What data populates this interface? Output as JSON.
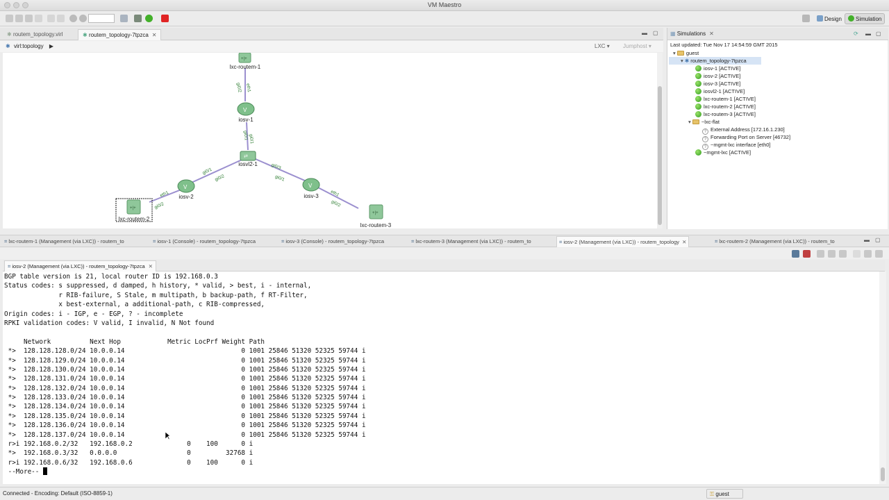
{
  "window": {
    "title": "VM Maestro"
  },
  "perspectives": {
    "design": "Design",
    "simulation": "Simulation"
  },
  "editor_tabs": [
    {
      "label": "routem_topology.virl"
    },
    {
      "label": "routem_topology-7tpzca"
    }
  ],
  "breadcrumb": {
    "label": "virl:topology"
  },
  "canvas_controls": {
    "lxc": "LXC",
    "jumphost": "Jumphost"
  },
  "topology": {
    "nodes": [
      {
        "id": "lxc-routem-1",
        "label": "lxc-routem-1",
        "kind": "lxc"
      },
      {
        "id": "iosv-1",
        "label": "iosv-1",
        "kind": "router"
      },
      {
        "id": "iosvl2-1",
        "label": "iosvl2-1",
        "kind": "switch"
      },
      {
        "id": "iosv-2",
        "label": "iosv-2",
        "kind": "router"
      },
      {
        "id": "iosv-3",
        "label": "iosv-3",
        "kind": "router"
      },
      {
        "id": "lxc-routem-2",
        "label": "lxc-routem-2",
        "kind": "lxc"
      },
      {
        "id": "lxc-routem-3",
        "label": "lxc-routem-3",
        "kind": "lxc"
      }
    ],
    "link_labels": [
      "gi0/2",
      "eth1",
      "gi0/1",
      "gi0/1",
      "gi0/1",
      "gi0/2",
      "gi0/3",
      "gi0/1",
      "eth1",
      "gi0/2",
      "gi0/2",
      "eth1"
    ]
  },
  "simulations": {
    "panel_title": "Simulations",
    "last_updated": "Last updated: Tue Nov 17 14:54:59 GMT 2015",
    "tree": [
      {
        "label": "guest",
        "icon": "folder",
        "level": 0
      },
      {
        "label": "routem_topology-7tpzca",
        "icon": "topology",
        "level": 1,
        "selected": true
      },
      {
        "label": "iosv-1  [ACTIVE]",
        "icon": "green",
        "level": 2
      },
      {
        "label": "iosv-2  [ACTIVE]",
        "icon": "green",
        "level": 2
      },
      {
        "label": "iosv-3  [ACTIVE]",
        "icon": "green",
        "level": 2
      },
      {
        "label": "iosvl2-1  [ACTIVE]",
        "icon": "green",
        "level": 2
      },
      {
        "label": "lxc-routem-1  [ACTIVE]",
        "icon": "green",
        "level": 2
      },
      {
        "label": "lxc-routem-2  [ACTIVE]",
        "icon": "green",
        "level": 2
      },
      {
        "label": "lxc-routem-3  [ACTIVE]",
        "icon": "green",
        "level": 2
      },
      {
        "label": "~lxc-flat",
        "icon": "folder",
        "level": 2
      },
      {
        "label": "External Address  [172.16.1.230]",
        "icon": "question",
        "level": 3
      },
      {
        "label": "Forwarding Port on Server  [46732]",
        "icon": "question",
        "level": 3
      },
      {
        "label": "~mgmt-lxc interface  [eth0]",
        "icon": "question",
        "level": 3
      },
      {
        "label": "~mgmt-lxc  [ACTIVE]",
        "icon": "green",
        "level": 2
      }
    ]
  },
  "console_tabs": [
    {
      "label": "lxc-routem-1  (Management (via LXC)) - routem_to"
    },
    {
      "label": "iosv-1  (Console) - routem_topology-7tpzca"
    },
    {
      "label": "iosv-3  (Console) - routem_topology-7tpzca"
    },
    {
      "label": "lxc-routem-3  (Management (via LXC)) - routem_to"
    },
    {
      "label": "iosv-2  (Management (via LXC)) - routem_topology",
      "active": true
    },
    {
      "label": "lxc-routem-2  (Management (via LXC)) - routem_to"
    }
  ],
  "terminal": {
    "tab_label": "iosv-2  (Management (via LXC)) - routem_topology-7tpzca",
    "lines": [
      "BGP table version is 21, local router ID is 192.168.0.3",
      "Status codes: s suppressed, d damped, h history, * valid, > best, i - internal,",
      "              r RIB-failure, S Stale, m multipath, b backup-path, f RT-Filter,",
      "              x best-external, a additional-path, c RIB-compressed,",
      "Origin codes: i - IGP, e - EGP, ? - incomplete",
      "RPKI validation codes: V valid, I invalid, N Not found",
      "",
      "     Network          Next Hop            Metric LocPrf Weight Path",
      " *>  128.128.128.0/24 10.0.0.14                              0 1001 25846 51320 52325 59744 i",
      " *>  128.128.129.0/24 10.0.0.14                              0 1001 25846 51320 52325 59744 i",
      " *>  128.128.130.0/24 10.0.0.14                              0 1001 25846 51320 52325 59744 i",
      " *>  128.128.131.0/24 10.0.0.14                              0 1001 25846 51320 52325 59744 i",
      " *>  128.128.132.0/24 10.0.0.14                              0 1001 25846 51320 52325 59744 i",
      " *>  128.128.133.0/24 10.0.0.14                              0 1001 25846 51320 52325 59744 i",
      " *>  128.128.134.0/24 10.0.0.14                              0 1001 25846 51320 52325 59744 i",
      " *>  128.128.135.0/24 10.0.0.14                              0 1001 25846 51320 52325 59744 i",
      " *>  128.128.136.0/24 10.0.0.14                              0 1001 25846 51320 52325 59744 i",
      " *>  128.128.137.0/24 10.0.0.14                              0 1001 25846 51320 52325 59744 i",
      " r>i 192.168.0.2/32   192.168.0.2              0    100      0 i",
      " *>  192.168.0.3/32   0.0.0.0                  0         32768 i",
      " r>i 192.168.0.6/32   192.168.0.6              0    100      0 i"
    ],
    "prompt": " --More-- "
  },
  "status": {
    "left": "Connected - Encoding: Default (ISO-8859-1)",
    "user": "guest"
  }
}
